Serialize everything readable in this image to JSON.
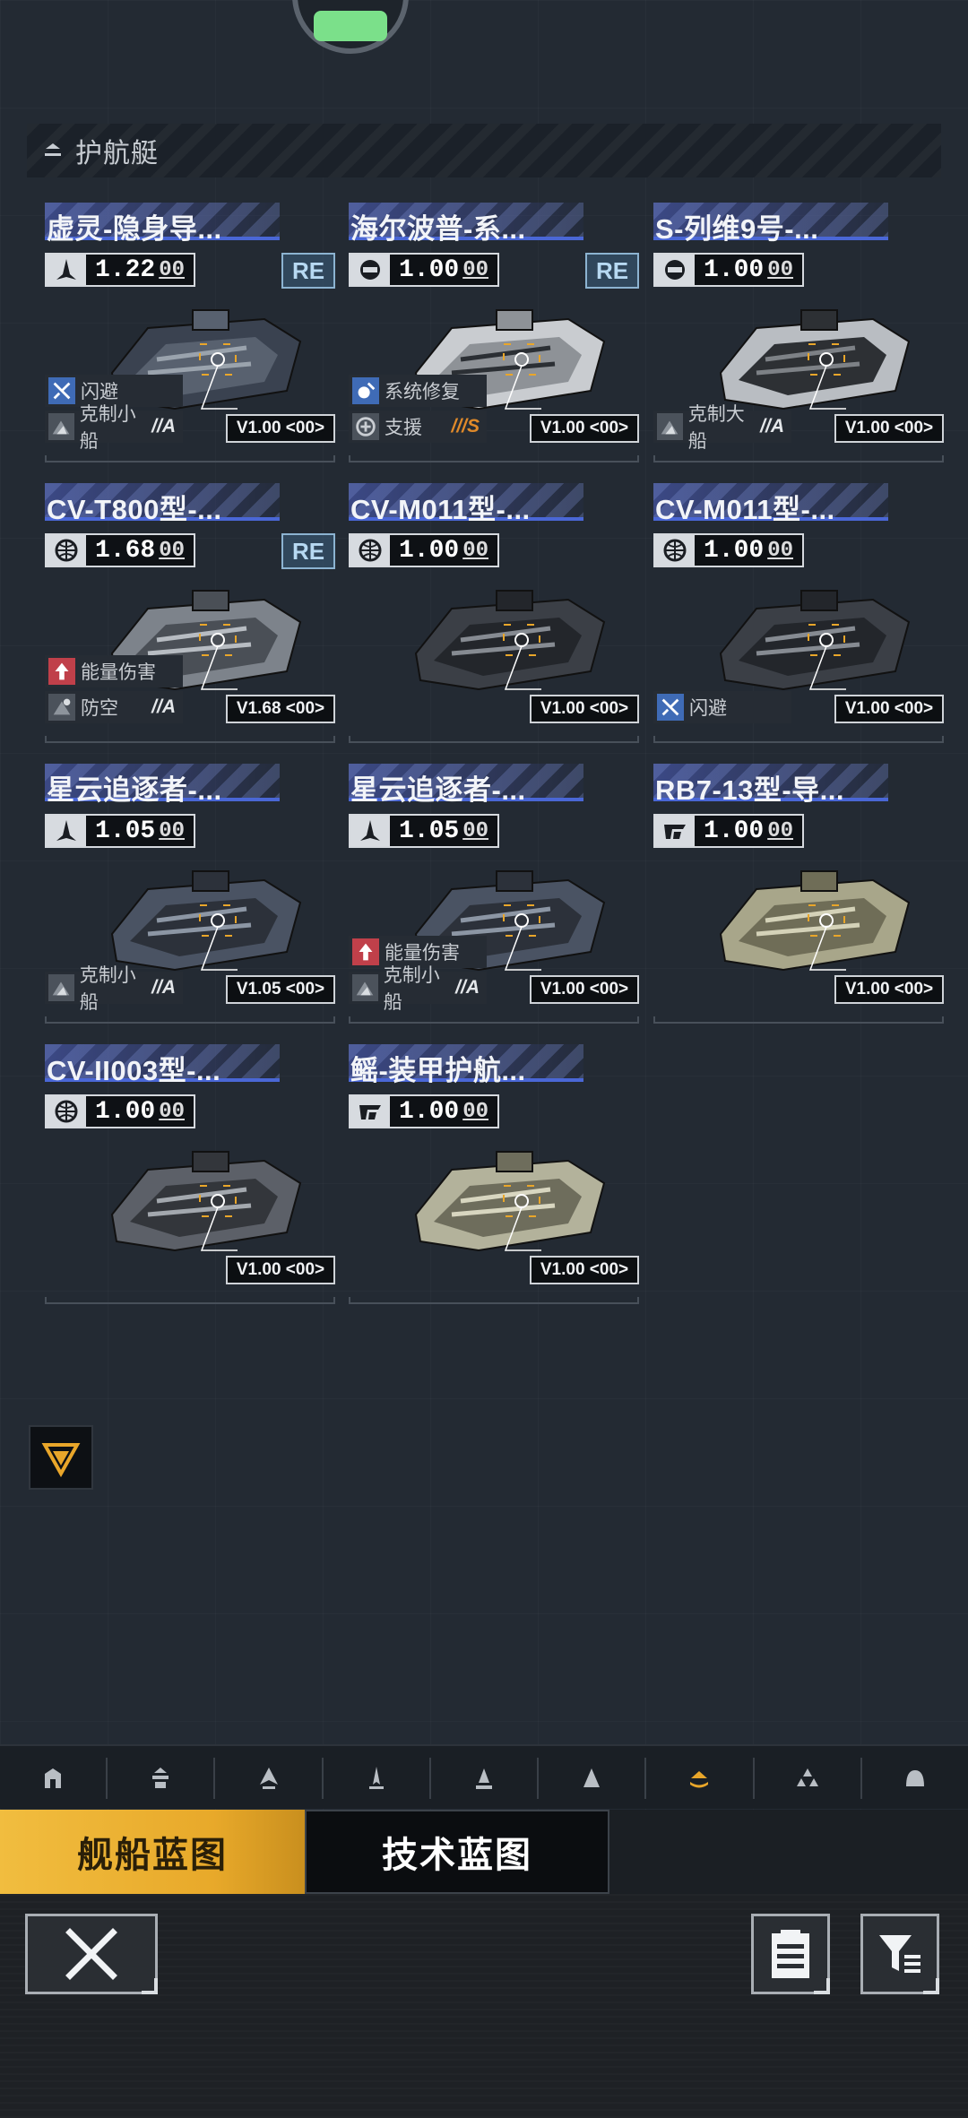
{
  "section": {
    "title": "护航艇",
    "icon": "escort-layer-icon"
  },
  "ships": [
    {
      "name": "虚灵-隐身导...",
      "rating_main": "1.22",
      "rating_sub": "00",
      "rating_icon": "fighter-icon",
      "re": "RE",
      "tag1": {
        "label": "闪避",
        "icon": "dodge-icon",
        "style": "blue"
      },
      "tag2": {
        "label": "克制小船",
        "icon": "counter-icon",
        "suffix": "//A",
        "style": "gray"
      },
      "version": "V1.00 <00>"
    },
    {
      "name": "海尔波普-系...",
      "rating_main": "1.00",
      "rating_sub": "00",
      "rating_icon": "helmet-icon",
      "re": "RE",
      "tag1": {
        "label": "系统修复",
        "icon": "repair-icon",
        "style": "blue"
      },
      "tag2": {
        "label": "支援",
        "icon": "support-icon",
        "suffix": "///S",
        "style": "gray",
        "suffix_orange": true
      },
      "version": "V1.00 <00>"
    },
    {
      "name": "S-列维9号-...",
      "rating_main": "1.00",
      "rating_sub": "00",
      "rating_icon": "helmet-icon",
      "re": "",
      "tag1": null,
      "tag2": {
        "label": "克制大船",
        "icon": "counter-icon",
        "suffix": "//A",
        "style": "gray"
      },
      "version": "V1.00 <00>"
    },
    {
      "name": "CV-T800型-...",
      "rating_main": "1.68",
      "rating_sub": "00",
      "rating_icon": "globe-icon",
      "re": "RE",
      "tag1": {
        "label": "能量伤害",
        "icon": "energy-icon",
        "style": "red"
      },
      "tag2": {
        "label": "防空",
        "icon": "antiair-icon",
        "suffix": "//A",
        "style": "gray"
      },
      "version": "V1.68 <00>"
    },
    {
      "name": "CV-M011型-...",
      "rating_main": "1.00",
      "rating_sub": "00",
      "rating_icon": "globe-icon",
      "re": "",
      "tag1": null,
      "tag2": null,
      "version": "V1.00 <00>"
    },
    {
      "name": "CV-M011型-...",
      "rating_main": "1.00",
      "rating_sub": "00",
      "rating_icon": "globe-icon",
      "re": "",
      "tag1": null,
      "tag2": {
        "label": "闪避",
        "icon": "dodge-icon",
        "suffix": "",
        "style": "blue"
      },
      "version": "V1.00 <00>"
    },
    {
      "name": "星云追逐者-...",
      "rating_main": "1.05",
      "rating_sub": "00",
      "rating_icon": "fighter-icon",
      "re": "",
      "tag1": null,
      "tag2": {
        "label": "克制小船",
        "icon": "counter-icon",
        "suffix": "//A",
        "style": "gray"
      },
      "version": "V1.05 <00>"
    },
    {
      "name": "星云追逐者-...",
      "rating_main": "1.05",
      "rating_sub": "00",
      "rating_icon": "fighter-icon",
      "re": "",
      "tag1": {
        "label": "能量伤害",
        "icon": "energy-icon",
        "style": "red"
      },
      "tag2": {
        "label": "克制小船",
        "icon": "counter-icon",
        "suffix": "//A",
        "style": "gray"
      },
      "version": "V1.00 <00>"
    },
    {
      "name": "RB7-13型-导...",
      "rating_main": "1.00",
      "rating_sub": "00",
      "rating_icon": "brand-icon",
      "re": "",
      "tag1": null,
      "tag2": null,
      "version": "V1.00 <00>"
    },
    {
      "name": "CV-II003型-...",
      "rating_main": "1.00",
      "rating_sub": "00",
      "rating_icon": "globe-icon",
      "re": "",
      "tag1": null,
      "tag2": null,
      "version": "V1.00 <00>"
    },
    {
      "name": "鳐-装甲护航...",
      "rating_main": "1.00",
      "rating_sub": "00",
      "rating_icon": "brand-icon",
      "re": "",
      "tag1": null,
      "tag2": null,
      "version": "V1.00 <00>"
    }
  ],
  "categories": [
    {
      "icon": "base-icon",
      "active": false
    },
    {
      "icon": "carrier-icon",
      "active": false
    },
    {
      "icon": "cruiser-icon",
      "active": false
    },
    {
      "icon": "destroyer-icon",
      "active": false
    },
    {
      "icon": "frigate-icon",
      "active": false
    },
    {
      "icon": "corvette-icon",
      "active": false
    },
    {
      "icon": "escort-icon",
      "active": true
    },
    {
      "icon": "squadron-icon",
      "active": false
    },
    {
      "icon": "dome-icon",
      "active": false
    }
  ],
  "tabs": {
    "ship_blueprint": "舰船蓝图",
    "tech_blueprint": "技术蓝图"
  },
  "colors": {
    "accent": "#f1bd3f",
    "name_bar": "#3e4c8e",
    "active_icon": "#e9a62a"
  }
}
